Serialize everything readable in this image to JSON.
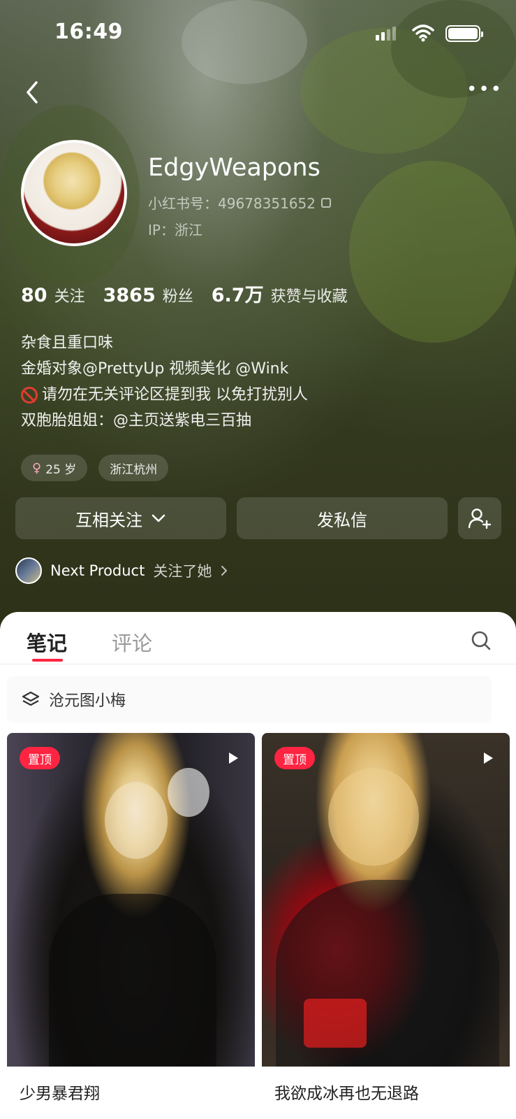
{
  "status_bar": {
    "time": "16:49"
  },
  "profile": {
    "username": "EdgyWeapons",
    "red_id": "小红书号：49678351652",
    "ip": "IP：浙江",
    "stats": [
      {
        "value": "80",
        "label": "关注"
      },
      {
        "value": "3865",
        "label": "粉丝"
      },
      {
        "value": "6.7万",
        "label": "获赞与收藏"
      }
    ],
    "bio": {
      "line1": "杂食且重口味",
      "line2": "金婚对象@PrettyUp 视频美化 @Wink",
      "line3": "请勿在无关评论区提到我 以免打扰别人",
      "line4": "双胞胎姐姐：@主页送紫电三百抽"
    },
    "tags": {
      "age": "25 岁",
      "location": "浙江杭州"
    },
    "actions": {
      "follow": "互相关注",
      "message": "发私信"
    },
    "mutual": {
      "name": "Next Product",
      "suffix": "关注了她"
    }
  },
  "tabs": {
    "notes": "笔记",
    "comments": "评论"
  },
  "collection": {
    "name": "沧元图小梅"
  },
  "notes": [
    {
      "badge": "置顶",
      "title": "少男暴君翔"
    },
    {
      "badge": "置顶",
      "title": "我欲成冰再也无退路"
    }
  ],
  "colors": {
    "accent": "#ff2442"
  }
}
